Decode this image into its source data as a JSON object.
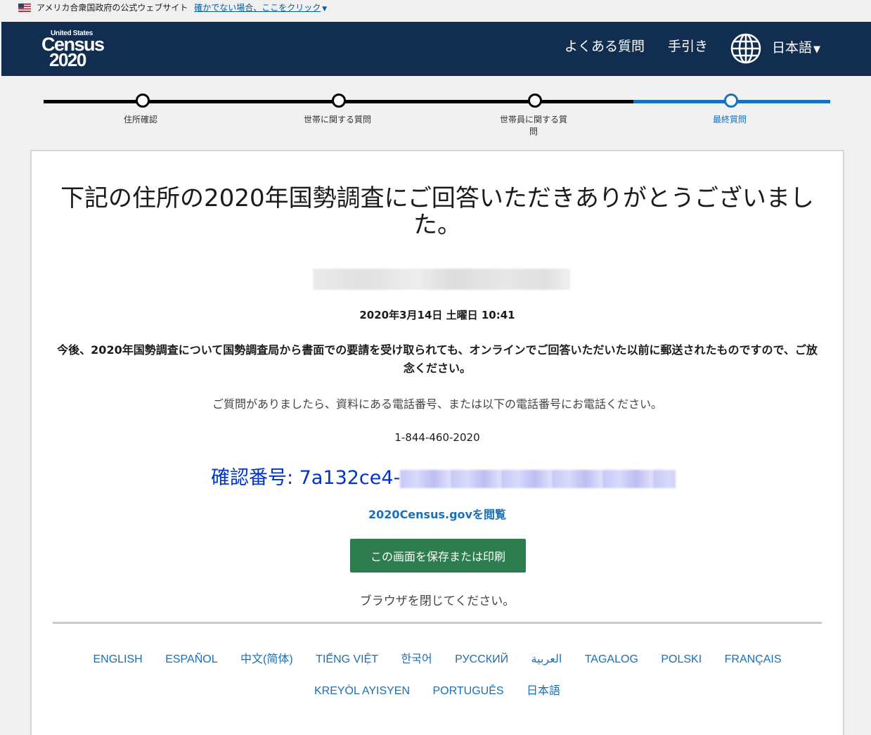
{
  "gov_banner": {
    "text": "アメリカ合衆国政府の公式ウェブサイト",
    "link": "確かでない場合、ここをクリック"
  },
  "header": {
    "logo_small": "United States",
    "logo_main": "Census",
    "logo_year": "2020",
    "nav_faq": "よくある質問",
    "nav_guide": "手引き",
    "language": "日本語"
  },
  "progress": {
    "steps": [
      {
        "label": "住所確認"
      },
      {
        "label": "世帯に関する質問"
      },
      {
        "label": "世帯員に関する質問"
      },
      {
        "label": "最終質問"
      }
    ]
  },
  "main": {
    "title": "下記の住所の2020年国勢調査にご回答いただきありがとうございました。",
    "datetime": "2020年3月14日 土曜日 10:41",
    "notice": "今後、2020年国勢調査について国勢調査局から書面での要請を受け取られても、オンラインでご回答いただいた以前に郵送されたものですので、ご放念ください。",
    "contact": "ご質問がありましたら、資料にある電話番号、または以下の電話番号にお電話ください。",
    "phone": "1-844-460-2020",
    "confirmation_label": "確認番号: 7a132ce4-",
    "site_link": "2020Census.govを閲覧",
    "save_button": "この画面を保存または印刷",
    "close_text": "ブラウザを閉じてください。"
  },
  "languages": [
    "ENGLISH",
    "ESPAÑOL",
    "中文(简体)",
    "TIẾNG VIỆT",
    "한국어",
    "РУССКИЙ",
    "العربية",
    "TAGALOG",
    "POLSKI",
    "FRANÇAIS",
    "KREYÒL AYISYEN",
    "PORTUGUÊS",
    "日本語"
  ],
  "colors": {
    "header_bg": "#112e51",
    "progress_active": "#1672c0",
    "button_green": "#2e7d4f",
    "link_blue": "#1a6fb7",
    "confirmation_blue": "#0033cc"
  }
}
